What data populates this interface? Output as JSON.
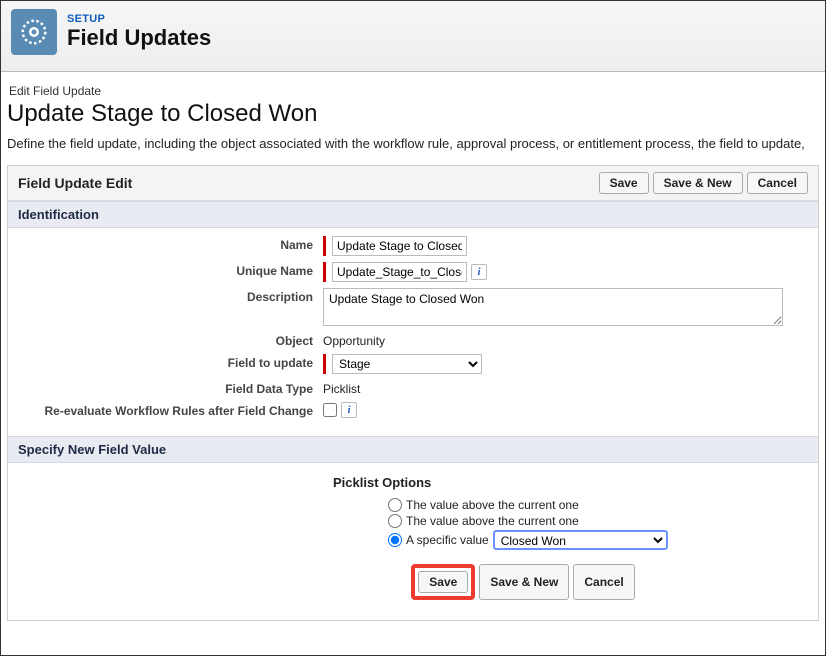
{
  "header": {
    "setup_label": "SETUP",
    "title": "Field Updates"
  },
  "page": {
    "breadcrumb": "Edit Field Update",
    "title": "Update Stage to Closed Won",
    "description": "Define the field update, including the object associated with the workflow rule, approval process, or entitlement process, the field to update,"
  },
  "panel": {
    "title": "Field Update Edit",
    "buttons": {
      "save": "Save",
      "save_new": "Save & New",
      "cancel": "Cancel"
    }
  },
  "sections": {
    "identification": "Identification",
    "specify": "Specify New Field Value"
  },
  "form": {
    "name": {
      "label": "Name",
      "value": "Update Stage to Closed"
    },
    "unique_name": {
      "label": "Unique Name",
      "value": "Update_Stage_to_Closed"
    },
    "description": {
      "label": "Description",
      "value": "Update Stage to Closed Won"
    },
    "object": {
      "label": "Object",
      "value": "Opportunity"
    },
    "field_to_update": {
      "label": "Field to update",
      "value": "Stage"
    },
    "field_data_type": {
      "label": "Field Data Type",
      "value": "Picklist"
    },
    "reevaluate": {
      "label": "Re-evaluate Workflow Rules after Field Change"
    }
  },
  "picklist": {
    "heading": "Picklist Options",
    "options": {
      "above1": "The value above the current one",
      "above2": "The value above the current one",
      "specific": "A specific value"
    },
    "specific_value": "Closed Won"
  }
}
